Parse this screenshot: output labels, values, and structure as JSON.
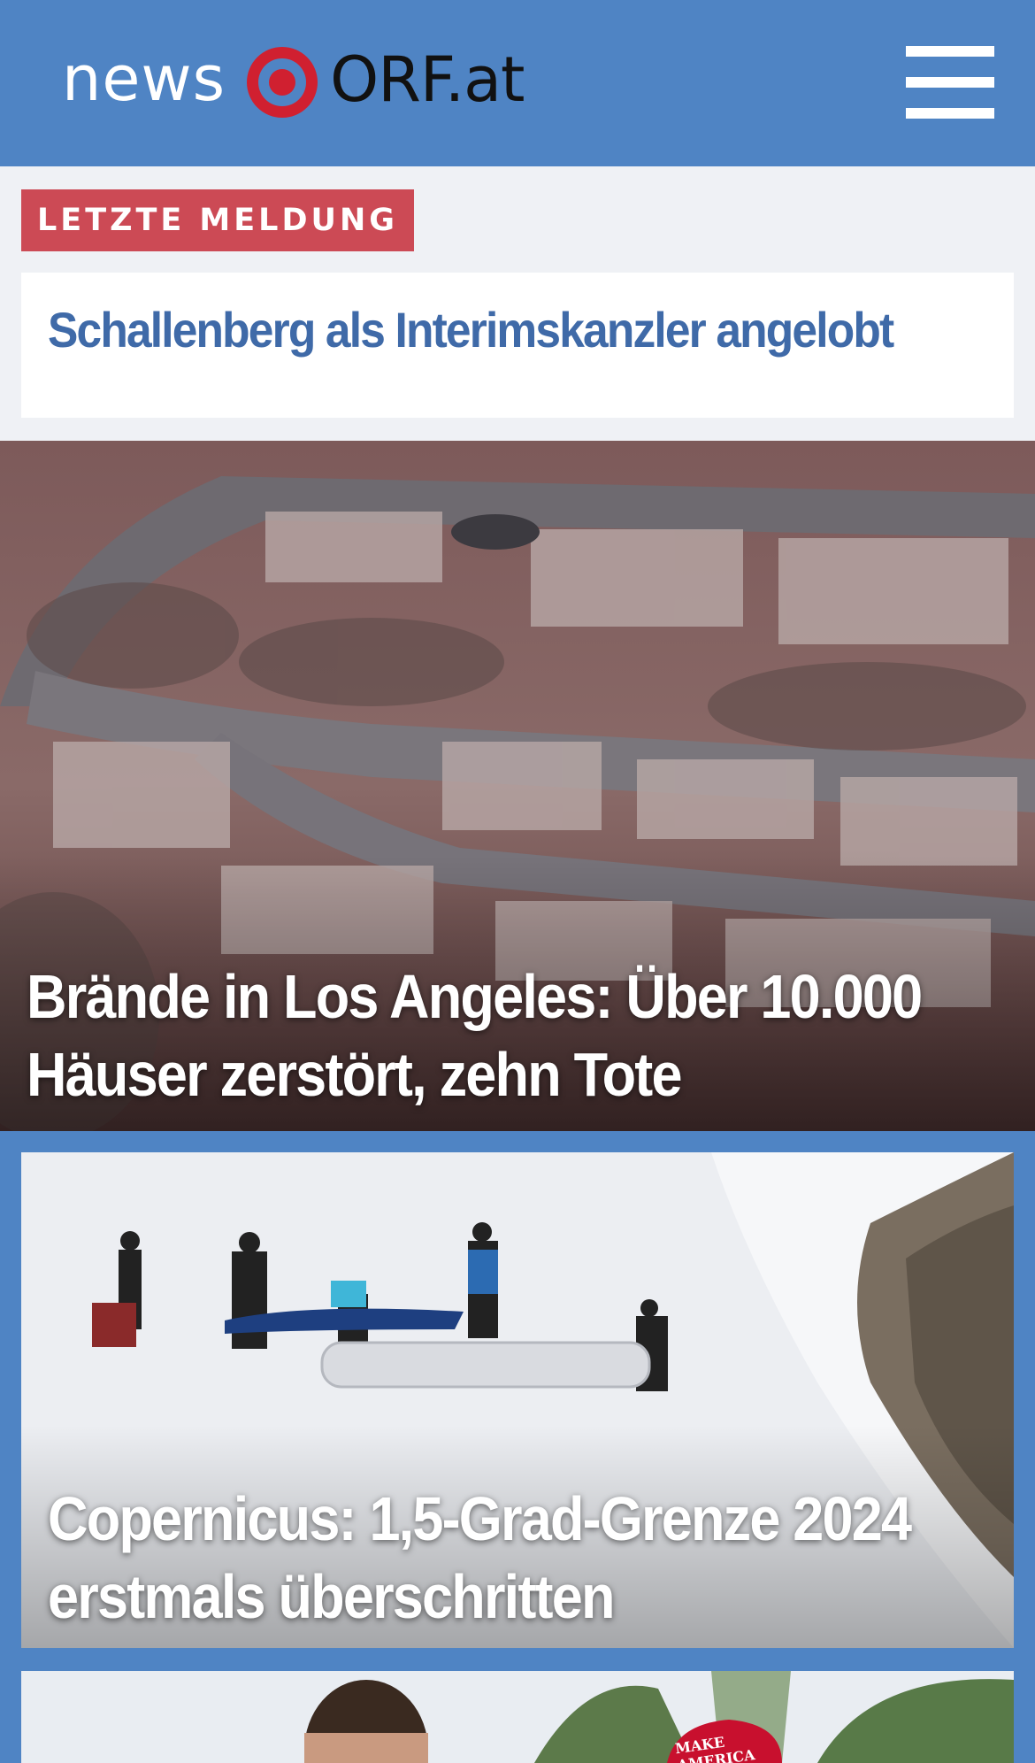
{
  "header": {
    "logo_news": "news",
    "logo_orf": "ORF.at",
    "menu_icon": "hamburger-menu-icon",
    "brand_color": "#4f84c4",
    "logo_red": "#d02030"
  },
  "breaking": {
    "badge": "LETZTE MELDUNG",
    "badge_color": "#cc4a55",
    "headline": "Schallenberg als Interimskanzler angelobt",
    "headline_color": "#3f6aa8"
  },
  "stories": [
    {
      "caption_line1": "Brände in Los Angeles: Über 10.000",
      "caption_line2": "Häuser zerstört, zehn Tote",
      "image": "aerial-photo-burned-neighborhood"
    },
    {
      "caption_line1": "Copernicus: 1,5-Grad-Grenze 2024",
      "caption_line2": "erstmals überschritten",
      "image": "photo-people-rolling-white-sheet-on-glacier"
    },
    {
      "image": "photo-man-and-red-cap-palm-trees",
      "cap_text": "MAKE AMERICA"
    }
  ]
}
